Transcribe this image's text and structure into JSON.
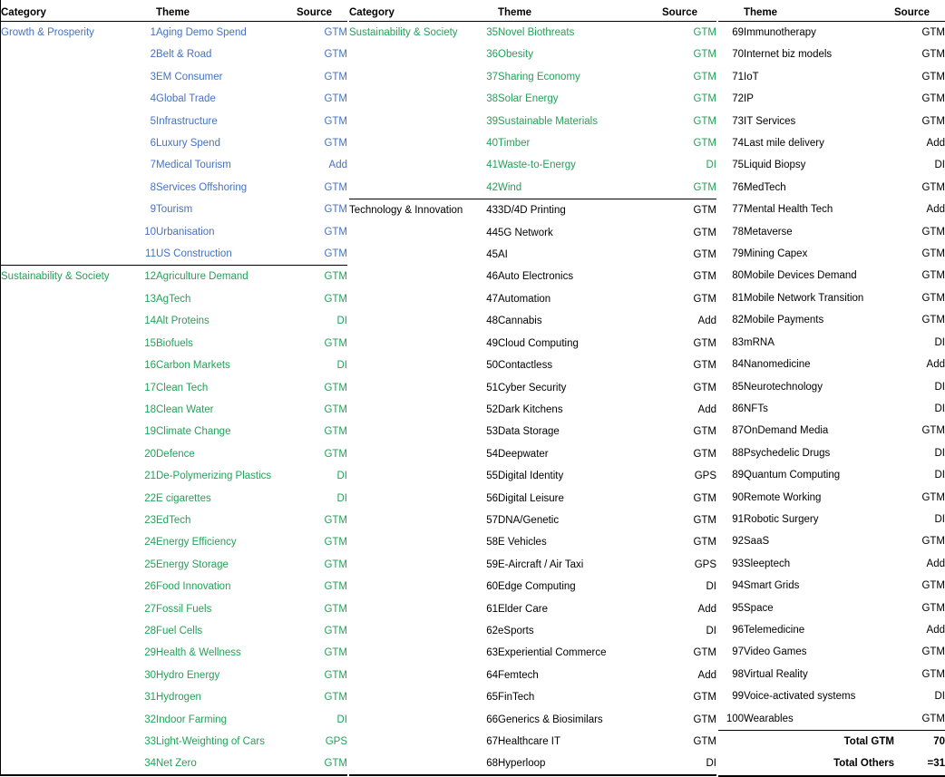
{
  "headers": {
    "category": "Category",
    "theme": "Theme",
    "source": "Source"
  },
  "colors": {
    "growth_prosperity": "#4472C4",
    "sustainability_society": "#24A158",
    "technology_innovation": "#000000",
    "rule": "#000000",
    "background": "#FFFFFF"
  },
  "categories": {
    "growth": "Growth & Prosperity",
    "sustainability": "Sustainability & Society",
    "technology": "Technology & Innovation"
  },
  "totals": {
    "gtm_label": "Total GTM",
    "gtm_value": "70",
    "others_label": "Total Others",
    "others_value": "=31"
  },
  "chart_data": {
    "type": "table",
    "title": "Theme list by Category and Source",
    "columns": [
      "Category",
      "#",
      "Theme",
      "Source"
    ],
    "rows": [
      {
        "n": "1",
        "theme": "Aging Demo Spend",
        "source": "GTM",
        "category": "Growth & Prosperity"
      },
      {
        "n": "2",
        "theme": "Belt & Road",
        "source": "GTM",
        "category": "Growth & Prosperity"
      },
      {
        "n": "3",
        "theme": "EM Consumer",
        "source": "GTM",
        "category": "Growth & Prosperity"
      },
      {
        "n": "4",
        "theme": "Global Trade",
        "source": "GTM",
        "category": "Growth & Prosperity"
      },
      {
        "n": "5",
        "theme": "Infrastructure",
        "source": "GTM",
        "category": "Growth & Prosperity"
      },
      {
        "n": "6",
        "theme": "Luxury Spend",
        "source": "GTM",
        "category": "Growth & Prosperity"
      },
      {
        "n": "7",
        "theme": "Medical Tourism",
        "source": "Add",
        "category": "Growth & Prosperity"
      },
      {
        "n": "8",
        "theme": "Services Offshoring",
        "source": "GTM",
        "category": "Growth & Prosperity"
      },
      {
        "n": "9",
        "theme": "Tourism",
        "source": "GTM",
        "category": "Growth & Prosperity"
      },
      {
        "n": "10",
        "theme": "Urbanisation",
        "source": "GTM",
        "category": "Growth & Prosperity"
      },
      {
        "n": "11",
        "theme": "US Construction",
        "source": "GTM",
        "category": "Growth & Prosperity"
      },
      {
        "n": "12",
        "theme": "Agriculture Demand",
        "source": "GTM",
        "category": "Sustainability & Society"
      },
      {
        "n": "13",
        "theme": "AgTech",
        "source": "GTM",
        "category": "Sustainability & Society"
      },
      {
        "n": "14",
        "theme": "Alt Proteins",
        "source": "DI",
        "category": "Sustainability & Society"
      },
      {
        "n": "15",
        "theme": "Biofuels",
        "source": "GTM",
        "category": "Sustainability & Society"
      },
      {
        "n": "16",
        "theme": "Carbon Markets",
        "source": "DI",
        "category": "Sustainability & Society"
      },
      {
        "n": "17",
        "theme": "Clean Tech",
        "source": "GTM",
        "category": "Sustainability & Society"
      },
      {
        "n": "18",
        "theme": "Clean Water",
        "source": "GTM",
        "category": "Sustainability & Society"
      },
      {
        "n": "19",
        "theme": "Climate Change",
        "source": "GTM",
        "category": "Sustainability & Society"
      },
      {
        "n": "20",
        "theme": "Defence",
        "source": "GTM",
        "category": "Sustainability & Society"
      },
      {
        "n": "21",
        "theme": "De-Polymerizing Plastics",
        "source": "DI",
        "category": "Sustainability & Society"
      },
      {
        "n": "22",
        "theme": "E cigarettes",
        "source": "DI",
        "category": "Sustainability & Society"
      },
      {
        "n": "23",
        "theme": "EdTech",
        "source": "GTM",
        "category": "Sustainability & Society"
      },
      {
        "n": "24",
        "theme": "Energy Efficiency",
        "source": "GTM",
        "category": "Sustainability & Society"
      },
      {
        "n": "25",
        "theme": "Energy Storage",
        "source": "GTM",
        "category": "Sustainability & Society"
      },
      {
        "n": "26",
        "theme": "Food Innovation",
        "source": "GTM",
        "category": "Sustainability & Society"
      },
      {
        "n": "27",
        "theme": "Fossil Fuels",
        "source": "GTM",
        "category": "Sustainability & Society"
      },
      {
        "n": "28",
        "theme": "Fuel Cells",
        "source": "GTM",
        "category": "Sustainability & Society"
      },
      {
        "n": "29",
        "theme": "Health & Wellness",
        "source": "GTM",
        "category": "Sustainability & Society"
      },
      {
        "n": "30",
        "theme": "Hydro Energy",
        "source": "GTM",
        "category": "Sustainability & Society"
      },
      {
        "n": "31",
        "theme": "Hydrogen",
        "source": "GTM",
        "category": "Sustainability & Society"
      },
      {
        "n": "32",
        "theme": "Indoor Farming",
        "source": "DI",
        "category": "Sustainability & Society"
      },
      {
        "n": "33",
        "theme": "Light-Weighting of Cars",
        "source": "GPS",
        "category": "Sustainability & Society"
      },
      {
        "n": "34",
        "theme": "Net Zero",
        "source": "GTM",
        "category": "Sustainability & Society"
      },
      {
        "n": "35",
        "theme": "Novel Biothreats",
        "source": "GTM",
        "category": "Sustainability & Society"
      },
      {
        "n": "36",
        "theme": "Obesity",
        "source": "GTM",
        "category": "Sustainability & Society"
      },
      {
        "n": "37",
        "theme": "Sharing Economy",
        "source": "GTM",
        "category": "Sustainability & Society"
      },
      {
        "n": "38",
        "theme": "Solar Energy",
        "source": "GTM",
        "category": "Sustainability & Society"
      },
      {
        "n": "39",
        "theme": "Sustainable Materials",
        "source": "GTM",
        "category": "Sustainability & Society"
      },
      {
        "n": "40",
        "theme": "Timber",
        "source": "GTM",
        "category": "Sustainability & Society"
      },
      {
        "n": "41",
        "theme": "Waste-to-Energy",
        "source": "DI",
        "category": "Sustainability & Society"
      },
      {
        "n": "42",
        "theme": "Wind",
        "source": "GTM",
        "category": "Sustainability & Society"
      },
      {
        "n": "43",
        "theme": "3D/4D Printing",
        "source": "GTM",
        "category": "Technology & Innovation"
      },
      {
        "n": "44",
        "theme": "5G Network",
        "source": "GTM",
        "category": "Technology & Innovation"
      },
      {
        "n": "45",
        "theme": "AI",
        "source": "GTM",
        "category": "Technology & Innovation"
      },
      {
        "n": "46",
        "theme": "Auto Electronics",
        "source": "GTM",
        "category": "Technology & Innovation"
      },
      {
        "n": "47",
        "theme": "Automation",
        "source": "GTM",
        "category": "Technology & Innovation"
      },
      {
        "n": "48",
        "theme": "Cannabis",
        "source": "Add",
        "category": "Technology & Innovation"
      },
      {
        "n": "49",
        "theme": "Cloud Computing",
        "source": "GTM",
        "category": "Technology & Innovation"
      },
      {
        "n": "50",
        "theme": "Contactless",
        "source": "GTM",
        "category": "Technology & Innovation"
      },
      {
        "n": "51",
        "theme": "Cyber Security",
        "source": "GTM",
        "category": "Technology & Innovation"
      },
      {
        "n": "52",
        "theme": "Dark Kitchens",
        "source": "Add",
        "category": "Technology & Innovation"
      },
      {
        "n": "53",
        "theme": "Data Storage",
        "source": "GTM",
        "category": "Technology & Innovation"
      },
      {
        "n": "54",
        "theme": "Deepwater",
        "source": "GTM",
        "category": "Technology & Innovation"
      },
      {
        "n": "55",
        "theme": "Digital Identity",
        "source": "GPS",
        "category": "Technology & Innovation"
      },
      {
        "n": "56",
        "theme": "Digital Leisure",
        "source": "GTM",
        "category": "Technology & Innovation"
      },
      {
        "n": "57",
        "theme": "DNA/Genetic",
        "source": "GTM",
        "category": "Technology & Innovation"
      },
      {
        "n": "58",
        "theme": "E Vehicles",
        "source": "GTM",
        "category": "Technology & Innovation"
      },
      {
        "n": "59",
        "theme": "E-Aircraft / Air Taxi",
        "source": "GPS",
        "category": "Technology & Innovation"
      },
      {
        "n": "60",
        "theme": "Edge Computing",
        "source": "DI",
        "category": "Technology & Innovation"
      },
      {
        "n": "61",
        "theme": "Elder Care",
        "source": "Add",
        "category": "Technology & Innovation"
      },
      {
        "n": "62",
        "theme": "eSports",
        "source": "DI",
        "category": "Technology & Innovation"
      },
      {
        "n": "63",
        "theme": "Experiential Commerce",
        "source": "GTM",
        "category": "Technology & Innovation"
      },
      {
        "n": "64",
        "theme": "Femtech",
        "source": "Add",
        "category": "Technology & Innovation"
      },
      {
        "n": "65",
        "theme": "FinTech",
        "source": "GTM",
        "category": "Technology & Innovation"
      },
      {
        "n": "66",
        "theme": "Generics & Biosimilars",
        "source": "GTM",
        "category": "Technology & Innovation"
      },
      {
        "n": "67",
        "theme": "Healthcare IT",
        "source": "GTM",
        "category": "Technology & Innovation"
      },
      {
        "n": "68",
        "theme": "Hyperloop",
        "source": "DI",
        "category": "Technology & Innovation"
      },
      {
        "n": "69",
        "theme": "Immunotherapy",
        "source": "GTM",
        "category": "Technology & Innovation"
      },
      {
        "n": "70",
        "theme": "Internet biz models",
        "source": "GTM",
        "category": "Technology & Innovation"
      },
      {
        "n": "71",
        "theme": "IoT",
        "source": "GTM",
        "category": "Technology & Innovation"
      },
      {
        "n": "72",
        "theme": "IP",
        "source": "GTM",
        "category": "Technology & Innovation"
      },
      {
        "n": "73",
        "theme": "IT Services",
        "source": "GTM",
        "category": "Technology & Innovation"
      },
      {
        "n": "74",
        "theme": "Last mile delivery",
        "source": "Add",
        "category": "Technology & Innovation"
      },
      {
        "n": "75",
        "theme": "Liquid Biopsy",
        "source": "DI",
        "category": "Technology & Innovation"
      },
      {
        "n": "76",
        "theme": "MedTech",
        "source": "GTM",
        "category": "Technology & Innovation"
      },
      {
        "n": "77",
        "theme": "Mental Health Tech",
        "source": "Add",
        "category": "Technology & Innovation"
      },
      {
        "n": "78",
        "theme": "Metaverse",
        "source": "GTM",
        "category": "Technology & Innovation"
      },
      {
        "n": "79",
        "theme": "Mining Capex",
        "source": "GTM",
        "category": "Technology & Innovation"
      },
      {
        "n": "80",
        "theme": "Mobile Devices Demand",
        "source": "GTM",
        "category": "Technology & Innovation"
      },
      {
        "n": "81",
        "theme": "Mobile Network Transition",
        "source": "GTM",
        "category": "Technology & Innovation"
      },
      {
        "n": "82",
        "theme": "Mobile Payments",
        "source": "GTM",
        "category": "Technology & Innovation"
      },
      {
        "n": "83",
        "theme": "mRNA",
        "source": "DI",
        "category": "Technology & Innovation"
      },
      {
        "n": "84",
        "theme": "Nanomedicine",
        "source": "Add",
        "category": "Technology & Innovation"
      },
      {
        "n": "85",
        "theme": "Neurotechnology",
        "source": "DI",
        "category": "Technology & Innovation"
      },
      {
        "n": "86",
        "theme": "NFTs",
        "source": "DI",
        "category": "Technology & Innovation"
      },
      {
        "n": "87",
        "theme": "OnDemand Media",
        "source": "GTM",
        "category": "Technology & Innovation"
      },
      {
        "n": "88",
        "theme": "Psychedelic Drugs",
        "source": "DI",
        "category": "Technology & Innovation"
      },
      {
        "n": "89",
        "theme": "Quantum Computing",
        "source": "DI",
        "category": "Technology & Innovation"
      },
      {
        "n": "90",
        "theme": "Remote Working",
        "source": "GTM",
        "category": "Technology & Innovation"
      },
      {
        "n": "91",
        "theme": "Robotic Surgery",
        "source": "DI",
        "category": "Technology & Innovation"
      },
      {
        "n": "92",
        "theme": "SaaS",
        "source": "GTM",
        "category": "Technology & Innovation"
      },
      {
        "n": "93",
        "theme": "Sleeptech",
        "source": "Add",
        "category": "Technology & Innovation"
      },
      {
        "n": "94",
        "theme": "Smart Grids",
        "source": "GTM",
        "category": "Technology & Innovation"
      },
      {
        "n": "95",
        "theme": "Space",
        "source": "GTM",
        "category": "Technology & Innovation"
      },
      {
        "n": "96",
        "theme": "Telemedicine",
        "source": "Add",
        "category": "Technology & Innovation"
      },
      {
        "n": "97",
        "theme": "Video Games",
        "source": "GTM",
        "category": "Technology & Innovation"
      },
      {
        "n": "98",
        "theme": "Virtual Reality",
        "source": "GTM",
        "category": "Technology & Innovation"
      },
      {
        "n": "99",
        "theme": "Voice-activated systems",
        "source": "DI",
        "category": "Technology & Innovation"
      },
      {
        "n": "100",
        "theme": "Wearables",
        "source": "GTM",
        "category": "Technology & Innovation"
      }
    ],
    "summary": {
      "Total GTM": 70,
      "Total Others": 31
    }
  },
  "panels": [
    {
      "show_category_column": true,
      "first_index": 0,
      "last_index": 33,
      "category_labels": [
        {
          "at_index": 0,
          "label": "Growth & Prosperity",
          "tone": "growth"
        },
        {
          "at_index": 11,
          "label": "Sustainability & Society",
          "tone": "sust"
        }
      ]
    },
    {
      "show_category_column": true,
      "first_index": 34,
      "last_index": 67,
      "category_labels": [
        {
          "at_index": 34,
          "label": "Sustainability & Society",
          "tone": "sust"
        },
        {
          "at_index": 42,
          "label": "Technology & Innovation",
          "tone": "tech"
        }
      ]
    },
    {
      "show_category_column": false,
      "first_index": 68,
      "last_index": 99,
      "category_labels": []
    }
  ]
}
